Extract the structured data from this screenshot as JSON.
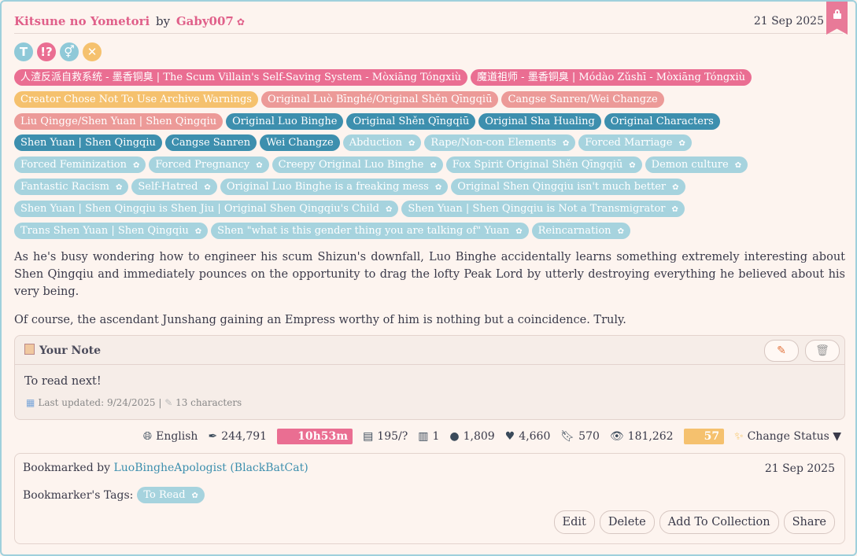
{
  "work": {
    "title": "Kitsune no Yometori",
    "by": "by",
    "author": "Gaby007",
    "date": "21 Sep 2025"
  },
  "required_tags": [
    {
      "icon": "T",
      "color": "#8fc9d8"
    },
    {
      "icon": "!?",
      "color": "#ea6e92"
    },
    {
      "icon": "⚥",
      "color": "#8fc9d8"
    },
    {
      "icon": "✕",
      "color": "#f5c16e"
    }
  ],
  "tag_rows": [
    [
      {
        "label": "人渣反派自救系统 - 墨香铜臭 | The Scum Villain's Self-Saving System - Mòxiāng Tóngxiù",
        "kind": "pink"
      },
      {
        "label": "魔道祖师 - 墨香铜臭 | Módào Zǔshī - Mòxiāng Tóngxiù",
        "kind": "pink"
      }
    ],
    [
      {
        "label": "Creator Chose Not To Use Archive Warnings",
        "kind": "orange"
      },
      {
        "label": "Original Luò Bīnghé/Original Shěn Qīngqiū",
        "kind": "salmon"
      },
      {
        "label": "Cangse Sanren/Wei Changze",
        "kind": "salmon"
      }
    ],
    [
      {
        "label": "Liu Qingge/Shen Yuan | Shen Qingqiu",
        "kind": "salmon"
      },
      {
        "label": "Original Luo Binghe",
        "kind": "dark"
      },
      {
        "label": "Original Shěn Qīngqiū",
        "kind": "dark"
      },
      {
        "label": "Original Sha Hualing",
        "kind": "dark"
      },
      {
        "label": "Original Characters",
        "kind": "dark"
      }
    ],
    [
      {
        "label": "Shen Yuan | Shen Qingqiu",
        "kind": "dark"
      },
      {
        "label": "Cangse Sanren",
        "kind": "dark"
      },
      {
        "label": "Wei Changze",
        "kind": "dark"
      },
      {
        "label": "Abduction",
        "kind": "light"
      },
      {
        "label": "Rape/Non-con Elements",
        "kind": "light"
      },
      {
        "label": "Forced Marriage",
        "kind": "light"
      }
    ],
    [
      {
        "label": "Forced Feminization",
        "kind": "light"
      },
      {
        "label": "Forced Pregnancy",
        "kind": "light"
      },
      {
        "label": "Creepy Original Luo Binghe",
        "kind": "light"
      },
      {
        "label": "Fox Spirit Original Shěn Qīngqiū",
        "kind": "light"
      },
      {
        "label": "Demon culture",
        "kind": "light"
      }
    ],
    [
      {
        "label": "Fantastic Racism",
        "kind": "light"
      },
      {
        "label": "Self-Hatred",
        "kind": "light"
      },
      {
        "label": "Original Luo Binghe is a freaking mess",
        "kind": "light"
      },
      {
        "label": "Original Shen Qingqiu isn't much better",
        "kind": "light"
      }
    ],
    [
      {
        "label": "Shen Yuan | Shen Qingqiu is Shen Jiu | Original Shen Qingqiu's Child",
        "kind": "light"
      },
      {
        "label": "Shen Yuan | Shen Qingqiu is Not a Transmigrator",
        "kind": "light"
      }
    ],
    [
      {
        "label": "Trans Shen Yuan | Shen Qingqiu",
        "kind": "light"
      },
      {
        "label": "Shen \"what is this gender thing you are talking of\" Yuan",
        "kind": "light"
      },
      {
        "label": "Reincarnation",
        "kind": "light"
      }
    ]
  ],
  "summary": [
    "As he's busy wondering how to engineer his scum Shizun's downfall, Luo Binghe accidentally learns something extremely interesting about Shen Qingqiu and immediately pounces on the opportunity to drag the lofty Peak Lord by utterly destroying everything he believed about his very being.",
    "Of course, the ascendant Junshang gaining an Empress worthy of him is nothing but a coincidence. Truly."
  ],
  "note": {
    "title": "Your Note",
    "text": "To read next!",
    "updated": "Last updated: 9/24/2025",
    "sep": "|",
    "chars": "13 characters"
  },
  "stats": {
    "language": "English",
    "words": "244,791",
    "read_time": "10h53m",
    "chapters": "195/?",
    "collections": "1",
    "comments": "1,809",
    "kudos": "4,660",
    "bookmarks": "570",
    "hits": "181,262",
    "score": "57",
    "change_status": "Change Status ▼"
  },
  "bookmark": {
    "by_label": "Bookmarked by",
    "user": "LuoBingheApologist (BlackBatCat)",
    "date": "21 Sep 2025",
    "tags_label": "Bookmarker's Tags:",
    "tags": [
      "To Read"
    ],
    "buttons": {
      "edit": "Edit",
      "delete": "Delete",
      "add_collection": "Add To Collection",
      "share": "Share"
    }
  }
}
